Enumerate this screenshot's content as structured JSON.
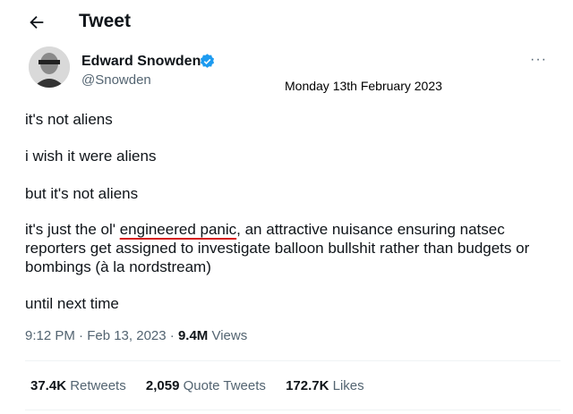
{
  "header": {
    "title": "Tweet",
    "back_icon": "arrow-left-icon"
  },
  "author": {
    "name": "Edward Snowden",
    "handle": "@Snowden",
    "verified_color": "#1d9bf0"
  },
  "caption": "Monday 13th February 2023",
  "tweet": {
    "p1": "it's not aliens",
    "p2": "i wish it were aliens",
    "p3": "but it's not aliens",
    "p4_pre": "it's just the ol' ",
    "p4_highlight": "engineered panic",
    "p4_post": ", an attractive nuisance ensuring natsec reporters get assigned to investigate balloon bullshit rather than budgets or bombings (à la nordstream)",
    "p5": "until next time"
  },
  "meta": {
    "time": "9:12 PM · Feb 13, 2023 · ",
    "views_count": "9.4M",
    "views_label": " Views"
  },
  "stats": {
    "retweets_count": "37.4K",
    "retweets_label": " Retweets",
    "quotes_count": "2,059",
    "quotes_label": " Quote Tweets",
    "likes_count": "172.7K",
    "likes_label": " Likes"
  },
  "more_label": "···"
}
